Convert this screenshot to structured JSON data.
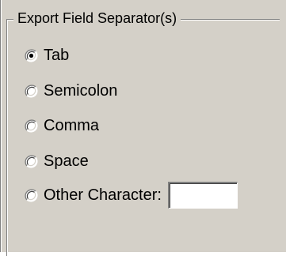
{
  "group": {
    "title": "Export Field Separator(s)"
  },
  "options": [
    {
      "label": "Tab",
      "checked": true
    },
    {
      "label": "Semicolon",
      "checked": false
    },
    {
      "label": "Comma",
      "checked": false
    },
    {
      "label": "Space",
      "checked": false
    },
    {
      "label": "Other Character:",
      "checked": false
    }
  ],
  "other_character": {
    "value": ""
  },
  "colors": {
    "panel_background": "#d4d0c8",
    "shadow": "#808080",
    "highlight": "#ffffff",
    "text": "#000000"
  }
}
